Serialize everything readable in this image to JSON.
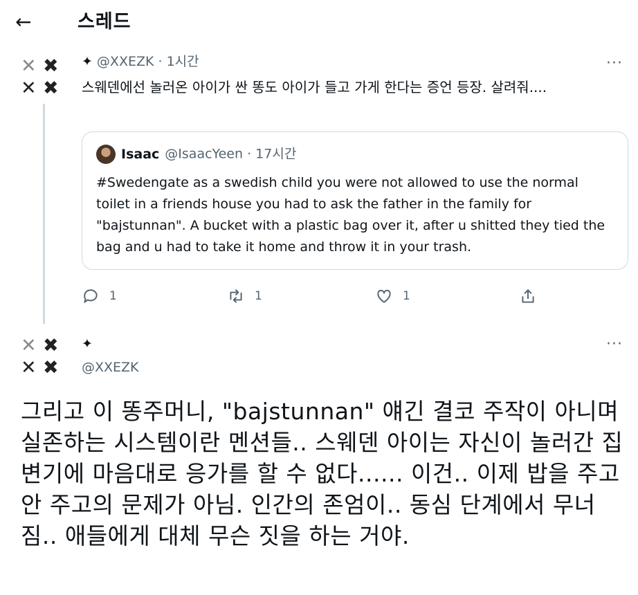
{
  "header": {
    "back_icon": "←",
    "title": "스레드"
  },
  "tweet1": {
    "handle": "@XXEZK",
    "time": "1시간",
    "text": "스웨덴에선 놀러온 아이가 싼 똥도 아이가 들고 가게 한다는 증언 등장. 살려줘....",
    "quote": {
      "name": "Isaac",
      "handle": "@IsaacYeen",
      "time": "17시간",
      "text": "#Swedengate as a swedish child you were not allowed to use the normal toilet in a friends house you had to ask the father in the family for \"bajstunnan\". A bucket with a plastic bag over it, after u shitted they tied the bag and u had to take it home and throw it in your trash."
    },
    "actions": {
      "replies": "1",
      "retweets": "1",
      "likes": "1"
    }
  },
  "tweet2": {
    "handle": "@XXEZK",
    "text": "그리고 이 똥주머니, \"bajstunnan\" 얘긴 결코 주작이 아니며 실존하는 시스템이란 멘션들.. 스웨덴 아이는 자신이 놀러간 집 변기에 마음대로 응가를 할 수 없다...... 이건.. 이제 밥을 주고 안 주고의 문제가 아님. 인간의 존엄이.. 동심 단계에서 무너짐.. 애들에게 대체 무슨 짓을 하는 거야."
  },
  "avatar_glyphs": {
    "a": "✕",
    "b": "✖"
  },
  "star": "✦",
  "more": "···",
  "sep": " · ",
  "colors": {
    "text": "#0f1419",
    "muted": "#536471",
    "border": "#cfd9de"
  }
}
